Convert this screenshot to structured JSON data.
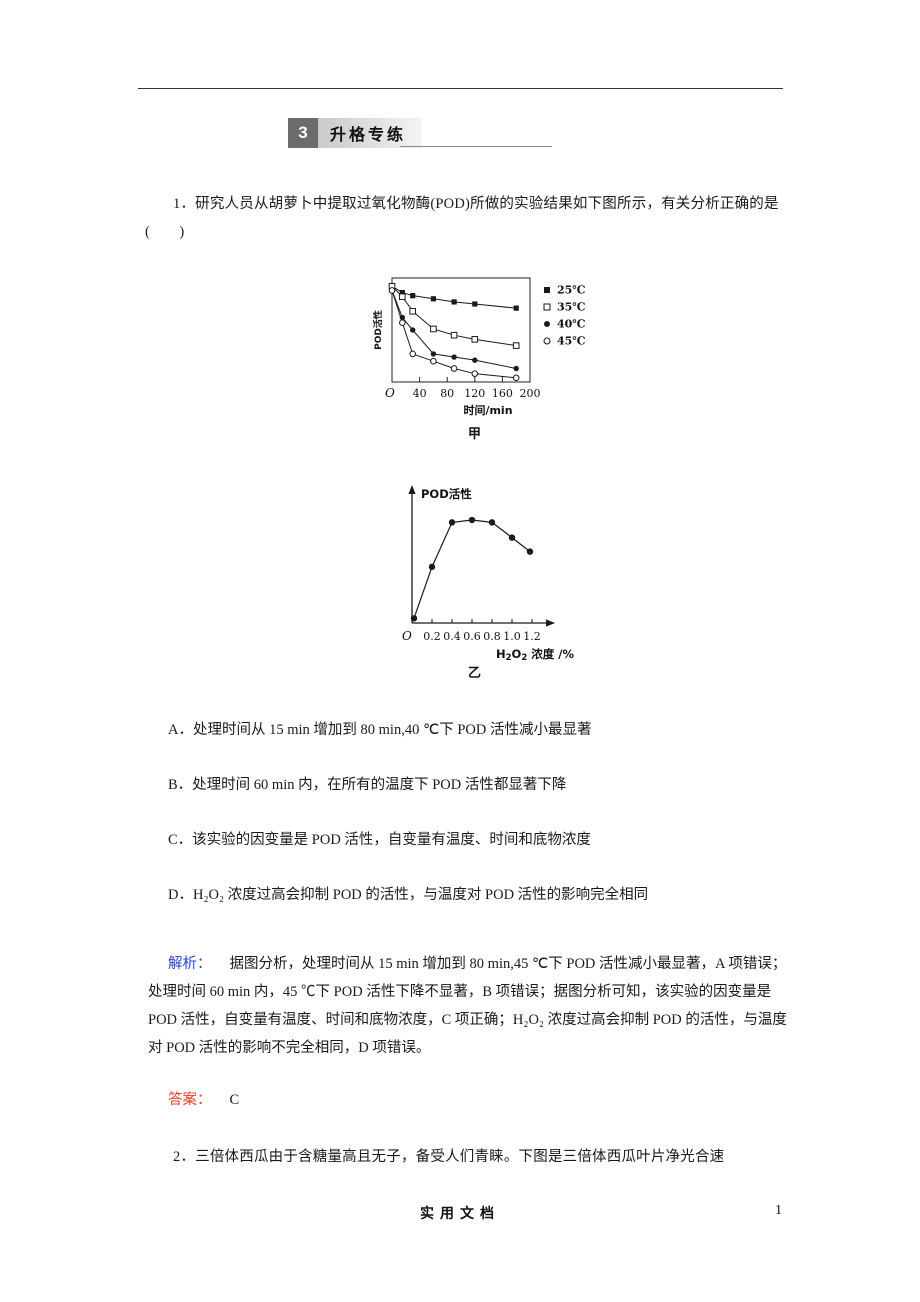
{
  "section": {
    "number": "3",
    "title": "升格专练"
  },
  "question1": {
    "text": "1．研究人员从胡萝卜中提取过氧化物酶(POD)所做的实验结果如下图所示，有关分析正确的是(　　)",
    "options": [
      "A．处理时间从 15 min 增加到 80 min,40 ℃下 POD 活性减小最显著",
      "B．处理时间 60 min 内，在所有的温度下 POD 活性都显著下降",
      "C．该实验的因变量是 POD 活性，自变量有温度、时间和底物浓度",
      "D．H₂O₂ 浓度过高会抑制 POD 的活性，与温度对 POD 活性的影响完全相同"
    ],
    "analysis_label": "解析：",
    "analysis_text": "据图分析，处理时间从 15 min 增加到 80 min,45 ℃下 POD 活性减小最显著，A 项错误；处理时间 60 min 内，45 ℃下 POD 活性下降不显著，B 项错误；据图分析可知，该实验的因变量是 POD 活性，自变量有温度、时间和底物浓度，C 项正确；H₂O₂ 浓度过高会抑制 POD 的活性，与温度对 POD 活性的影响不完全相同，D 项错误。",
    "answer_label": "答案：",
    "answer_value": "C"
  },
  "question2": {
    "text": "2．三倍体西瓜由于含糖量高且无子，备受人们青睐。下图是三倍体西瓜叶片净光合速"
  },
  "figure1_caption": "甲",
  "figure2_caption": "乙",
  "footer": {
    "center": "实用文档",
    "page": "1"
  },
  "chart_data": [
    {
      "type": "line",
      "id": "chart-jia",
      "title": "",
      "xlabel": "时间/min",
      "ylabel": "POD活性",
      "origin_label": "O",
      "xticks": [
        "40",
        "80",
        "120",
        "160",
        "200"
      ],
      "xtick_values": [
        40,
        80,
        120,
        160,
        200
      ],
      "xlim": [
        0,
        200
      ],
      "ylim": [
        0,
        100
      ],
      "grid": false,
      "legend_position": "right",
      "legend": [
        "25℃",
        "35℃",
        "40℃",
        "45℃"
      ],
      "x": [
        0,
        15,
        30,
        60,
        90,
        120,
        180
      ],
      "series": [
        {
          "name": "25℃",
          "marker": "filled-square",
          "values": [
            92,
            86,
            83,
            80,
            77,
            75,
            71
          ]
        },
        {
          "name": "35℃",
          "marker": "open-square",
          "values": [
            92,
            82,
            68,
            51,
            45,
            41,
            35
          ]
        },
        {
          "name": "40℃",
          "marker": "filled-circle",
          "values": [
            88,
            62,
            50,
            27,
            24,
            21,
            13
          ]
        },
        {
          "name": "45℃",
          "marker": "open-circle",
          "values": [
            88,
            57,
            27,
            20,
            13,
            8,
            4
          ]
        }
      ]
    },
    {
      "type": "line",
      "id": "chart-yi",
      "title": "POD活性",
      "xlabel": "H₂O₂浓度/%",
      "ylabel": "POD活性",
      "origin_label": "O",
      "xticks": [
        "0.2",
        "0.4",
        "0.6",
        "0.8",
        "1.0",
        "1.2"
      ],
      "xtick_values": [
        0.2,
        0.4,
        0.6,
        0.8,
        1.0,
        1.2
      ],
      "xlim": [
        0,
        1.35
      ],
      "ylim": [
        0,
        100
      ],
      "grid": false,
      "legend_position": "none",
      "legend": [],
      "x": [
        0.02,
        0.2,
        0.4,
        0.6,
        0.8,
        1.0,
        1.18
      ],
      "series": [
        {
          "name": "POD活性",
          "marker": "filled-circle",
          "values": [
            4,
            48,
            86,
            88,
            86,
            73,
            61
          ]
        }
      ]
    }
  ]
}
